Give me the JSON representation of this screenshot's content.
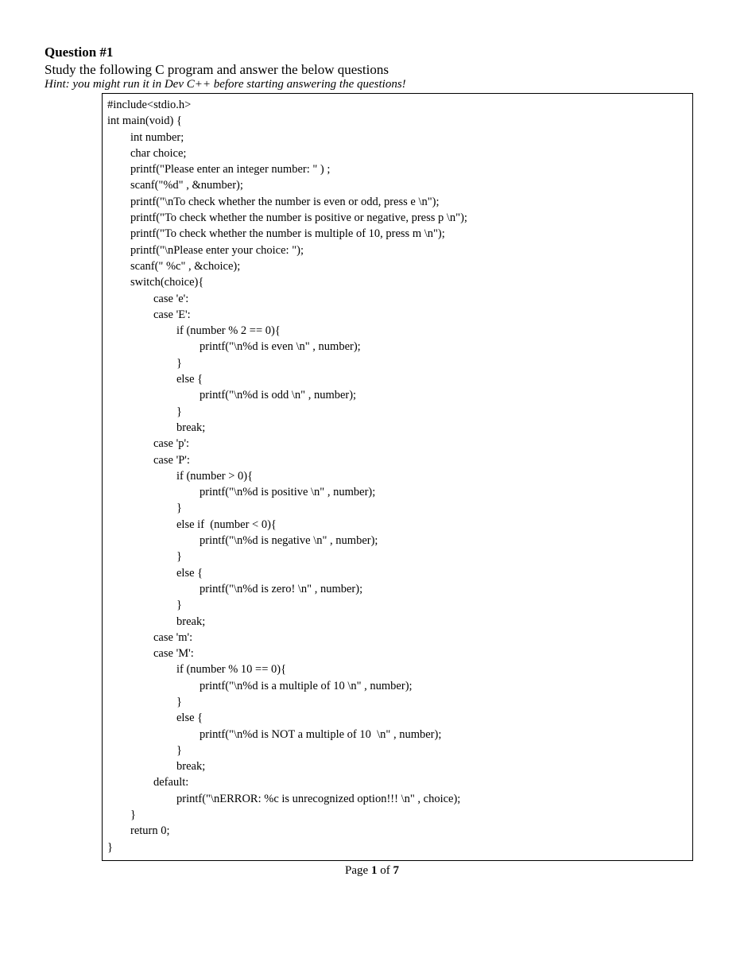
{
  "question": {
    "title": "Question #1",
    "prompt": "Study the following C program and answer the below questions",
    "hint": "Hint: you might run it in Dev C++ before starting answering the questions!"
  },
  "code": {
    "lines": [
      "#include<stdio.h>",
      "int main(void) {",
      "        int number;",
      "        char choice;",
      "        printf(\"Please enter an integer number: \" ) ;",
      "        scanf(\"%d\" , &number);",
      "        printf(\"\\nTo check whether the number is even or odd, press e \\n\");",
      "        printf(\"To check whether the number is positive or negative, press p \\n\");",
      "        printf(\"To check whether the number is multiple of 10, press m \\n\");",
      "        printf(\"\\nPlease enter your choice: \");",
      "        scanf(\" %c\" , &choice);",
      "        switch(choice){",
      "                case 'e':",
      "                case 'E':",
      "                        if (number % 2 == 0){",
      "                                printf(\"\\n%d is even \\n\" , number);",
      "                        }",
      "                        else {",
      "                                printf(\"\\n%d is odd \\n\" , number);",
      "                        }",
      "                        break;",
      "                case 'p':",
      "                case 'P':",
      "                        if (number > 0){",
      "                                printf(\"\\n%d is positive \\n\" , number);",
      "                        }",
      "                        else if  (number < 0){",
      "                                printf(\"\\n%d is negative \\n\" , number);",
      "                        }",
      "                        else {",
      "                                printf(\"\\n%d is zero! \\n\" , number);",
      "                        }",
      "                        break;",
      "                case 'm':",
      "                case 'M':",
      "                        if (number % 10 == 0){",
      "                                printf(\"\\n%d is a multiple of 10 \\n\" , number);",
      "                        }",
      "                        else {",
      "                                printf(\"\\n%d is NOT a multiple of 10  \\n\" , number);",
      "                        }",
      "                        break;",
      "                default:",
      "                        printf(\"\\nERROR: %c is unrecognized option!!! \\n\" , choice);",
      "        }",
      "        return 0;",
      "}"
    ]
  },
  "page_indicator": {
    "prefix": "Page ",
    "current": "1",
    "middle": " of ",
    "total": "7"
  }
}
